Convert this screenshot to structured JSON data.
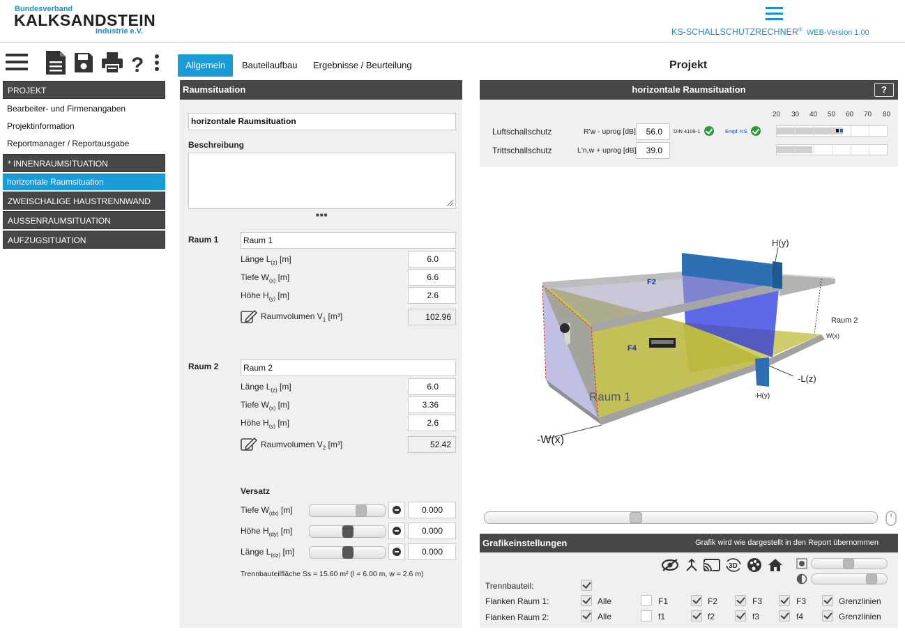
{
  "header": {
    "logo_line1": "Bundesverband",
    "logo_line2": "KALKSANDSTEIN",
    "logo_line3": "Industrie e.V.",
    "app_name": "KS-SCHALLSCHUTZRECHNER",
    "app_reg": "®",
    "version": "WEB-Version 1.00"
  },
  "sidebar": {
    "project_header": "PROJEKT",
    "project_links": [
      "Bearbeiter- und Firmenangaben",
      "Projektinformation",
      "Reportmanager / Reportausgabe"
    ],
    "inner_header": "* INNENRAUMSITUATION",
    "active_item": "horizontale Raumsituation",
    "sections": [
      "ZWEISCHALIGE HAUSTRENNWAND",
      "AUSSENRAUMSITUATION",
      "AUFZUGSITUATION"
    ]
  },
  "tabs": [
    "Allgemein",
    "Bauteilaufbau",
    "Ergebnisse / Beurteilung"
  ],
  "form": {
    "panel_title": "Raumsituation",
    "situation_name": "horizontale Raumsituation",
    "description_label": "Beschreibung",
    "description_value": "",
    "more": "■■■",
    "room1": {
      "label": "Raum 1",
      "name": "Raum 1",
      "length_label": "Länge L",
      "length_sub": "(z)",
      "length_unit": " [m]",
      "length": "6.0",
      "depth_label": "Tiefe W",
      "depth_sub": "(x)",
      "depth_unit": " [m]",
      "depth": "6.6",
      "height_label": "Höhe H",
      "height_sub": "(y)",
      "height_unit": " [m]",
      "height": "2.6",
      "volume_label": "Raumvolumen V",
      "volume_sub": "1",
      "volume_unit": " [m³]",
      "volume": "102.96"
    },
    "room2": {
      "label": "Raum 2",
      "name": "Raum 2",
      "length": "6.0",
      "depth": "3.36",
      "height": "2.6",
      "volume_sub": "2",
      "volume": "52.42"
    },
    "offset": {
      "title": "Versatz",
      "dx_label": "Tiefe W",
      "dx_sub": "(dx)",
      "dx": "0.000",
      "dy_label": "Höhe H",
      "dy_sub": "(dy)",
      "dy": "0.000",
      "dz_label": "Länge L",
      "dz_sub": "(dz)",
      "dz": "0.000",
      "unit": " [m]"
    },
    "footer_note": "Trennbauteilfläche Ss = 15.60 m² (l = 6.00 m, w = 2.6 m)"
  },
  "right": {
    "title": "Projekt",
    "panel_title": "horizontale Raumsituation",
    "help": "?",
    "scale": [
      "20",
      "30",
      "40",
      "50",
      "60",
      "70",
      "80"
    ],
    "airborne_label": "Luftschallschutz",
    "airborne_formula": "R'w - uprog [dB]",
    "airborne_value": "56.0",
    "din_label": "DIN 4109-1",
    "empf_label": "Empf. KS",
    "airborne_fraction": 0.6,
    "impact_label": "Trittschallschutz",
    "impact_formula": "L'n,w + uprog [dB]",
    "impact_value": "39.0",
    "impact_fraction": 0.32
  },
  "graphic_labels": {
    "hy": "H(y)",
    "f2": "F2",
    "raum2": "Raum 2",
    "wx": "W(x)",
    "f4": "F4",
    "lz": "-L(z)",
    "mhy": "-H(y)",
    "raum1": "Raum 1",
    "mwx": "-W(x)"
  },
  "graphics_settings": {
    "title": "Grafikeinstellungen",
    "note": "Grafik wird wie dargestellt in den Report übernommen",
    "trenn_label": "Trennbauteil:",
    "flank1_label": "Flanken Raum 1:",
    "flank2_label": "Flanken Raum 2:",
    "row1": [
      "Alle",
      "F1",
      "F2",
      "F3",
      "F3",
      "Grenzlinien"
    ],
    "row2": [
      "Alle",
      "f1",
      "f2",
      "f3",
      "f4",
      "Grenzlinien"
    ]
  }
}
